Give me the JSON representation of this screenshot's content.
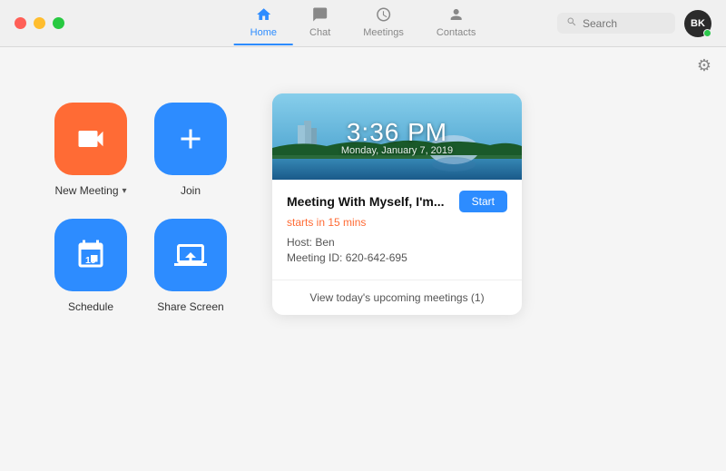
{
  "titlebar": {
    "controls": [
      "close",
      "minimize",
      "maximize"
    ],
    "nav": [
      {
        "id": "home",
        "label": "Home",
        "active": true
      },
      {
        "id": "chat",
        "label": "Chat",
        "active": false
      },
      {
        "id": "meetings",
        "label": "Meetings",
        "active": false
      },
      {
        "id": "contacts",
        "label": "Contacts",
        "active": false
      }
    ],
    "search_placeholder": "Search",
    "avatar_initials": "BK"
  },
  "settings_icon": "⚙",
  "actions": [
    {
      "id": "new-meeting",
      "label": "New Meeting",
      "has_dropdown": true,
      "color": "orange",
      "icon_type": "camera"
    },
    {
      "id": "join",
      "label": "Join",
      "has_dropdown": false,
      "color": "blue",
      "icon_type": "plus"
    },
    {
      "id": "schedule",
      "label": "Schedule",
      "has_dropdown": false,
      "color": "blue",
      "icon_type": "calendar"
    },
    {
      "id": "share-screen",
      "label": "Share Screen",
      "has_dropdown": false,
      "color": "blue",
      "icon_type": "share"
    }
  ],
  "meeting_card": {
    "time": "3:36 PM",
    "date": "Monday, January 7, 2019",
    "title": "Meeting With Myself, I'm...",
    "start_label": "Start",
    "starts_in": "starts in 15 mins",
    "host_label": "Host:",
    "host_name": "Ben",
    "meeting_id_label": "Meeting ID:",
    "meeting_id": "620-642-695",
    "footer_link": "View today's upcoming meetings (1)"
  }
}
